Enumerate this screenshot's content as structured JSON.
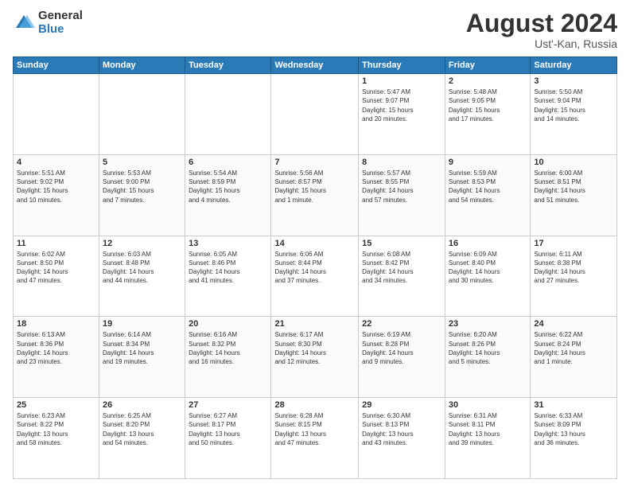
{
  "logo": {
    "general": "General",
    "blue": "Blue"
  },
  "header": {
    "month_year": "August 2024",
    "location": "Ust'-Kan, Russia"
  },
  "days_of_week": [
    "Sunday",
    "Monday",
    "Tuesday",
    "Wednesday",
    "Thursday",
    "Friday",
    "Saturday"
  ],
  "weeks": [
    [
      {
        "day": "",
        "info": ""
      },
      {
        "day": "",
        "info": ""
      },
      {
        "day": "",
        "info": ""
      },
      {
        "day": "",
        "info": ""
      },
      {
        "day": "1",
        "info": "Sunrise: 5:47 AM\nSunset: 9:07 PM\nDaylight: 15 hours\nand 20 minutes."
      },
      {
        "day": "2",
        "info": "Sunrise: 5:48 AM\nSunset: 9:05 PM\nDaylight: 15 hours\nand 17 minutes."
      },
      {
        "day": "3",
        "info": "Sunrise: 5:50 AM\nSunset: 9:04 PM\nDaylight: 15 hours\nand 14 minutes."
      }
    ],
    [
      {
        "day": "4",
        "info": "Sunrise: 5:51 AM\nSunset: 9:02 PM\nDaylight: 15 hours\nand 10 minutes."
      },
      {
        "day": "5",
        "info": "Sunrise: 5:53 AM\nSunset: 9:00 PM\nDaylight: 15 hours\nand 7 minutes."
      },
      {
        "day": "6",
        "info": "Sunrise: 5:54 AM\nSunset: 8:59 PM\nDaylight: 15 hours\nand 4 minutes."
      },
      {
        "day": "7",
        "info": "Sunrise: 5:56 AM\nSunset: 8:57 PM\nDaylight: 15 hours\nand 1 minute."
      },
      {
        "day": "8",
        "info": "Sunrise: 5:57 AM\nSunset: 8:55 PM\nDaylight: 14 hours\nand 57 minutes."
      },
      {
        "day": "9",
        "info": "Sunrise: 5:59 AM\nSunset: 8:53 PM\nDaylight: 14 hours\nand 54 minutes."
      },
      {
        "day": "10",
        "info": "Sunrise: 6:00 AM\nSunset: 8:51 PM\nDaylight: 14 hours\nand 51 minutes."
      }
    ],
    [
      {
        "day": "11",
        "info": "Sunrise: 6:02 AM\nSunset: 8:50 PM\nDaylight: 14 hours\nand 47 minutes."
      },
      {
        "day": "12",
        "info": "Sunrise: 6:03 AM\nSunset: 8:48 PM\nDaylight: 14 hours\nand 44 minutes."
      },
      {
        "day": "13",
        "info": "Sunrise: 6:05 AM\nSunset: 8:46 PM\nDaylight: 14 hours\nand 41 minutes."
      },
      {
        "day": "14",
        "info": "Sunrise: 6:06 AM\nSunset: 8:44 PM\nDaylight: 14 hours\nand 37 minutes."
      },
      {
        "day": "15",
        "info": "Sunrise: 6:08 AM\nSunset: 8:42 PM\nDaylight: 14 hours\nand 34 minutes."
      },
      {
        "day": "16",
        "info": "Sunrise: 6:09 AM\nSunset: 8:40 PM\nDaylight: 14 hours\nand 30 minutes."
      },
      {
        "day": "17",
        "info": "Sunrise: 6:11 AM\nSunset: 8:38 PM\nDaylight: 14 hours\nand 27 minutes."
      }
    ],
    [
      {
        "day": "18",
        "info": "Sunrise: 6:13 AM\nSunset: 8:36 PM\nDaylight: 14 hours\nand 23 minutes."
      },
      {
        "day": "19",
        "info": "Sunrise: 6:14 AM\nSunset: 8:34 PM\nDaylight: 14 hours\nand 19 minutes."
      },
      {
        "day": "20",
        "info": "Sunrise: 6:16 AM\nSunset: 8:32 PM\nDaylight: 14 hours\nand 16 minutes."
      },
      {
        "day": "21",
        "info": "Sunrise: 6:17 AM\nSunset: 8:30 PM\nDaylight: 14 hours\nand 12 minutes."
      },
      {
        "day": "22",
        "info": "Sunrise: 6:19 AM\nSunset: 8:28 PM\nDaylight: 14 hours\nand 9 minutes."
      },
      {
        "day": "23",
        "info": "Sunrise: 6:20 AM\nSunset: 8:26 PM\nDaylight: 14 hours\nand 5 minutes."
      },
      {
        "day": "24",
        "info": "Sunrise: 6:22 AM\nSunset: 8:24 PM\nDaylight: 14 hours\nand 1 minute."
      }
    ],
    [
      {
        "day": "25",
        "info": "Sunrise: 6:23 AM\nSunset: 8:22 PM\nDaylight: 13 hours\nand 58 minutes."
      },
      {
        "day": "26",
        "info": "Sunrise: 6:25 AM\nSunset: 8:20 PM\nDaylight: 13 hours\nand 54 minutes."
      },
      {
        "day": "27",
        "info": "Sunrise: 6:27 AM\nSunset: 8:17 PM\nDaylight: 13 hours\nand 50 minutes."
      },
      {
        "day": "28",
        "info": "Sunrise: 6:28 AM\nSunset: 8:15 PM\nDaylight: 13 hours\nand 47 minutes."
      },
      {
        "day": "29",
        "info": "Sunrise: 6:30 AM\nSunset: 8:13 PM\nDaylight: 13 hours\nand 43 minutes."
      },
      {
        "day": "30",
        "info": "Sunrise: 6:31 AM\nSunset: 8:11 PM\nDaylight: 13 hours\nand 39 minutes."
      },
      {
        "day": "31",
        "info": "Sunrise: 6:33 AM\nSunset: 8:09 PM\nDaylight: 13 hours\nand 36 minutes."
      }
    ]
  ]
}
